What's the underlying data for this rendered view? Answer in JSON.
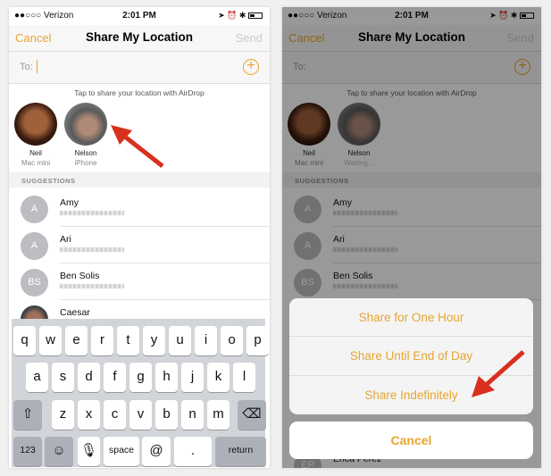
{
  "status": {
    "carrier": "●●○○○ Verizon",
    "wifi": "wifi-icon",
    "time": "2:01 PM",
    "icons": "➤ ⏰ ✱"
  },
  "nav": {
    "cancel": "Cancel",
    "title": "Share My Location",
    "send": "Send"
  },
  "to": {
    "label": "To:",
    "value": ""
  },
  "airdrop": {
    "hint": "Tap to share your location with AirDrop",
    "people": [
      {
        "name": "Neil",
        "device": "Mac mini"
      },
      {
        "name": "Nelson",
        "device": "iPhone",
        "device_waiting": "Waiting..."
      }
    ]
  },
  "suggestions": {
    "header": "SUGGESTIONS",
    "contacts": [
      {
        "initials": "A",
        "name": "Amy"
      },
      {
        "initials": "A",
        "name": "Ari"
      },
      {
        "initials": "BS",
        "name": "Ben Solis"
      },
      {
        "initials": "",
        "name": "Caesar"
      },
      {
        "initials": "EP",
        "name": "Erica Perez"
      }
    ]
  },
  "keyboard": {
    "row1": [
      "q",
      "w",
      "e",
      "r",
      "t",
      "y",
      "u",
      "i",
      "o",
      "p"
    ],
    "row2": [
      "a",
      "s",
      "d",
      "f",
      "g",
      "h",
      "j",
      "k",
      "l"
    ],
    "row3": [
      "z",
      "x",
      "c",
      "v",
      "b",
      "n",
      "m"
    ],
    "shift": "⇧",
    "delete": "⌫",
    "numbers": "123",
    "emoji": "☺",
    "mic": "🎙",
    "space": "space",
    "at": "@",
    "period": ".",
    "return": "return"
  },
  "action_sheet": {
    "options": [
      "Share for One Hour",
      "Share Until End of Day",
      "Share Indefinitely"
    ],
    "cancel": "Cancel"
  },
  "colors": {
    "accent": "#e8a530",
    "arrow": "#d9301e"
  }
}
